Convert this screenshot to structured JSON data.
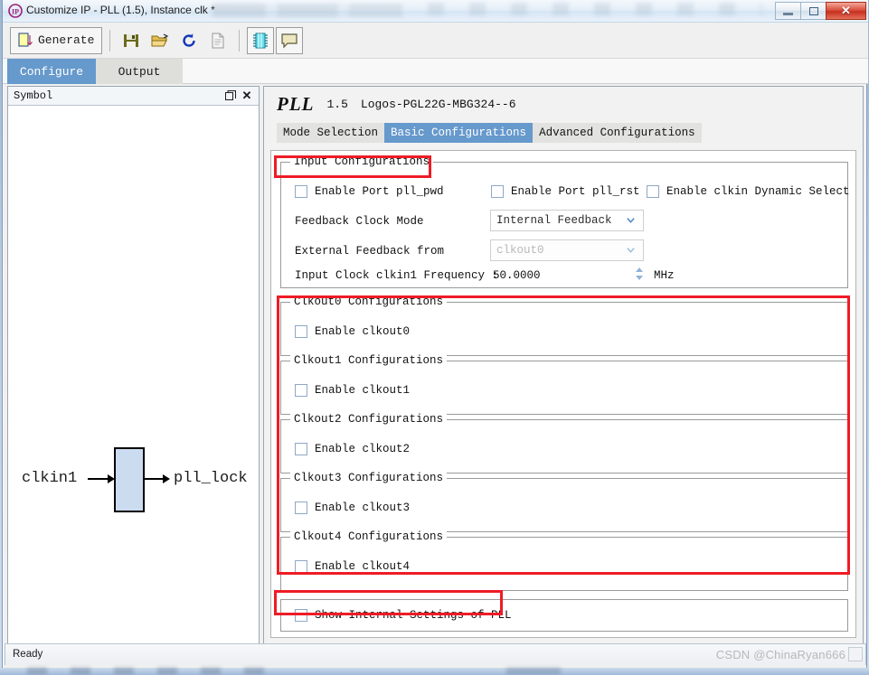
{
  "window": {
    "title": "Customize IP - PLL (1.5), Instance clk *",
    "app_icon": "ip-logo-icon",
    "minimize_label": "Minimize",
    "maximize_label": "Restore",
    "close_label": "Close"
  },
  "toolbar": {
    "generate_label": "Generate",
    "buttons": [
      {
        "name": "generate-button",
        "icon": "generate-icon",
        "label": "Generate"
      },
      {
        "name": "save-button",
        "icon": "floppy-save-icon",
        "label": ""
      },
      {
        "name": "open-button",
        "icon": "open-folder-icon",
        "label": ""
      },
      {
        "name": "refresh-button",
        "icon": "refresh-icon",
        "label": ""
      },
      {
        "name": "report-button",
        "icon": "document-report-icon",
        "label": ""
      },
      {
        "name": "symbol-view-button",
        "icon": "chip-symbol-icon",
        "label": ""
      },
      {
        "name": "message-button",
        "icon": "speech-bubble-icon",
        "label": ""
      }
    ]
  },
  "primary_tabs": [
    {
      "label": "Configure",
      "active": true
    },
    {
      "label": "Output",
      "active": false
    }
  ],
  "symbol_dock": {
    "title": "Symbol",
    "float_icon": "float-window-icon",
    "close_icon": "close-icon",
    "input_port": "clkin1",
    "output_port": "pll_lock"
  },
  "panel": {
    "ip_name": "PLL",
    "version": "1.5",
    "device": "Logos-PGL22G-MBG324--6",
    "sub_tabs": [
      {
        "label": "Mode Selection",
        "active": false
      },
      {
        "label": "Basic Configurations",
        "active": true
      },
      {
        "label": "Advanced Configurations",
        "active": false
      }
    ]
  },
  "input_configurations": {
    "legend": "Input Configurations",
    "checkboxes": [
      {
        "label": "Enable Port pll_pwd",
        "checked": false
      },
      {
        "label": "Enable Port pll_rst",
        "checked": false
      },
      {
        "label": "Enable clkin Dynamic Select",
        "checked": false
      }
    ],
    "feedback_clock_mode": {
      "label": "Feedback Clock Mode",
      "value": "Internal Feedback",
      "disabled": false
    },
    "external_feedback_from": {
      "label": "External Feedback from",
      "value": "clkout0",
      "disabled": true
    },
    "input_clock_frequency": {
      "label": "Input Clock clkin1 Frequency :",
      "value": "50.0000",
      "unit": "MHz"
    }
  },
  "clkout_groups": [
    {
      "legend": "Clkout0 Configurations",
      "checkbox_label": "Enable clkout0",
      "checked": false
    },
    {
      "legend": "Clkout1 Configurations",
      "checkbox_label": "Enable clkout1",
      "checked": false
    },
    {
      "legend": "Clkout2 Configurations",
      "checkbox_label": "Enable clkout2",
      "checked": false
    },
    {
      "legend": "Clkout3 Configurations",
      "checkbox_label": "Enable clkout3",
      "checked": false
    },
    {
      "legend": "Clkout4 Configurations",
      "checkbox_label": "Enable clkout4",
      "checked": false
    }
  ],
  "internal_settings": {
    "label": "Show Internal Settings of PLL",
    "checked": false
  },
  "status": {
    "text": "Ready",
    "watermark": "CSDN @ChinaRyan666"
  },
  "colors": {
    "accent_blue": "#6699cc",
    "annotation_red": "#ee1c25",
    "symbol_fill": "#ccdcf0",
    "checkbox_border": "#8ea8c6",
    "close_red": "#c6301e"
  }
}
